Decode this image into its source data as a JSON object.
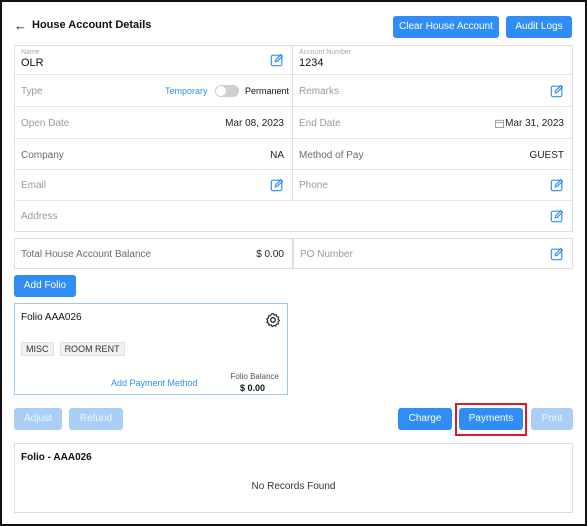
{
  "header": {
    "back_glyph": "←",
    "title": "House Account Details",
    "clear_btn": "Clear House Account",
    "audit_btn": "Audit Logs"
  },
  "fields": {
    "name_label": "Name",
    "name_value": "OLR",
    "acct_label": "Account Number",
    "acct_value": "1234",
    "type_label": "Type",
    "type_option_active": "Temporary",
    "type_option_inactive": "Permanent",
    "remarks_label": "Remarks",
    "open_date_label": "Open Date",
    "open_date_value": "Mar 08, 2023",
    "end_date_label": "End Date",
    "end_date_value": "Mar 31, 2023",
    "company_label": "Company",
    "company_value": "NA",
    "method_label": "Method of Pay",
    "method_value": "GUEST",
    "email_label": "Email",
    "phone_label": "Phone",
    "address_label": "Address"
  },
  "balance": {
    "label": "Total House Account Balance",
    "value": "$ 0.00",
    "po_label": "PO Number"
  },
  "folio": {
    "add_btn": "Add Folio",
    "title": "Folio AAA026",
    "tags": [
      "MISC",
      "ROOM RENT"
    ],
    "add_payment": "Add Payment Method",
    "balance_label": "Folio Balance",
    "balance_value": "$ 0.00"
  },
  "actions": {
    "adjust": "Adjust",
    "refund": "Refund",
    "charge": "Charge",
    "payments": "Payments",
    "print": "Print"
  },
  "records": {
    "title": "Folio - AAA026",
    "empty": "No Records Found"
  },
  "colors": {
    "accent": "#2f8df5",
    "disabled": "#a9cff7",
    "highlight": "#d91e2b"
  }
}
